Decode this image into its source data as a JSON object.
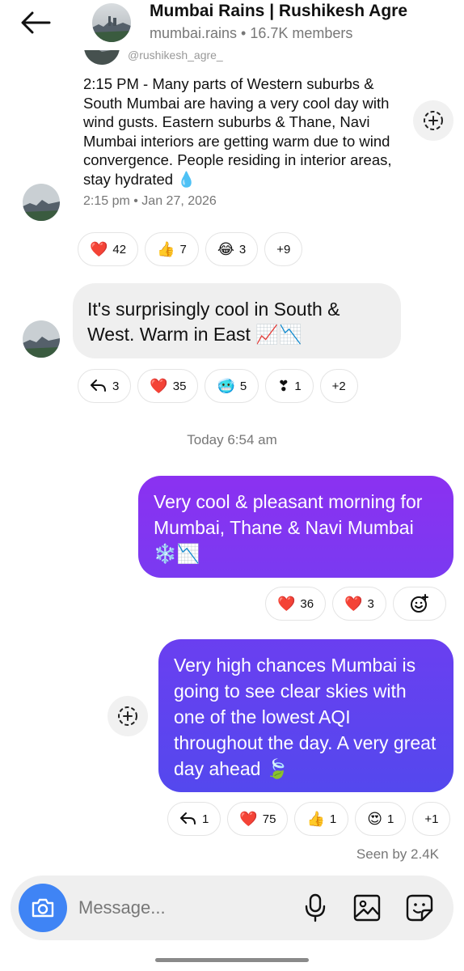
{
  "header": {
    "title": "Mumbai Rains | Rushikesh Agre",
    "subtitle": "mumbai.rains • 16.7K members"
  },
  "message1": {
    "handle": "@rushikesh_agre_",
    "text": "2:15 PM - Many parts of Western suburbs & South Mumbai are having a very cool day with wind gusts. Eastern suburbs & Thane, Navi Mumbai interiors are getting warm due to wind convergence. People residing in interior areas, stay hydrated 💧",
    "meta": "2:15 pm • Jan 27, 2026",
    "reactions": [
      {
        "emoji": "❤️",
        "count": "42"
      },
      {
        "emoji": "👍",
        "count": "7"
      },
      {
        "emoji": "😂",
        "count": "3"
      },
      {
        "emoji": "",
        "count": "+9"
      }
    ]
  },
  "message2": {
    "text": "It's surprisingly cool in South & West. Warm in East 📈📉",
    "reactions": [
      {
        "emoji": "reply-icon",
        "count": "3"
      },
      {
        "emoji": "❤️",
        "count": "35"
      },
      {
        "emoji": "🥶",
        "count": "5"
      },
      {
        "emoji": "❣",
        "count": "1"
      },
      {
        "emoji": "",
        "count": "+2"
      }
    ]
  },
  "timestamp": "Today 6:54 am",
  "message3": {
    "text": "Very cool & pleasant morning for Mumbai, Thane & Navi Mumbai ❄️📉",
    "reactions": [
      {
        "emoji": "❤️",
        "count": "36"
      },
      {
        "emoji": "❤️",
        "count": "3"
      },
      {
        "emoji": "add-emoji-icon",
        "count": ""
      }
    ]
  },
  "message4": {
    "text": "Very high chances Mumbai is going to see clear skies with one of the lowest AQI throughout the day. A very great day ahead 🍃",
    "reactions": [
      {
        "emoji": "reply-icon",
        "count": "1"
      },
      {
        "emoji": "❤️",
        "count": "75"
      },
      {
        "emoji": "👍",
        "count": "1"
      },
      {
        "emoji": "😍",
        "count": "1"
      },
      {
        "emoji": "",
        "count": "+1"
      }
    ]
  },
  "seen": "Seen by 2.4K",
  "composer": {
    "placeholder": "Message..."
  },
  "colors": {
    "outgoing_bubble_1": "#8b31f1",
    "outgoing_bubble_2": "#5a45ef",
    "incoming_bubble": "#efefef",
    "camera_button": "#3f84f5"
  }
}
